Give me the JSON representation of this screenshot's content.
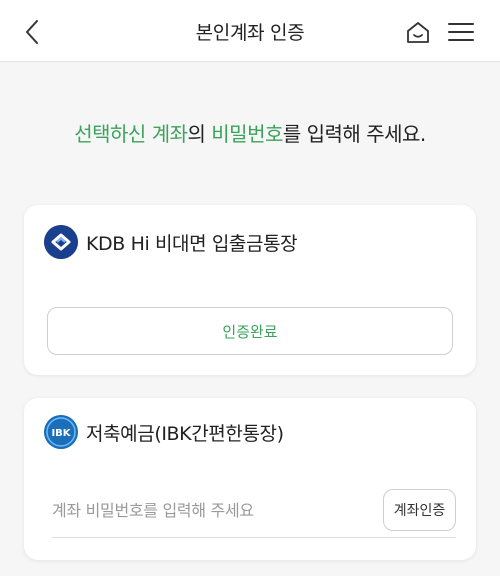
{
  "header": {
    "title": "본인계좌 인증",
    "back_icon": "chevron-left-icon",
    "home_icon": "home-icon",
    "menu_icon": "hamburger-menu-icon"
  },
  "instruction": {
    "part1": "선택하신 계좌",
    "part2": "의 ",
    "part3": "비밀번호",
    "part4": "를 입력해 주세요.",
    "highlight_color": "#3ba35b"
  },
  "accounts": [
    {
      "name": "KDB Hi 비대면 입출금통장",
      "logo_icon": "kdb-bank-logo",
      "status_label": "인증완료"
    },
    {
      "name": "저축예금(IBK간편한통장)",
      "logo_icon": "ibk-bank-logo",
      "logo_text": "IBK",
      "password_placeholder": "계좌 비밀번호를 입력해 주세요",
      "password_value": "",
      "verify_label": "계좌인증"
    }
  ]
}
